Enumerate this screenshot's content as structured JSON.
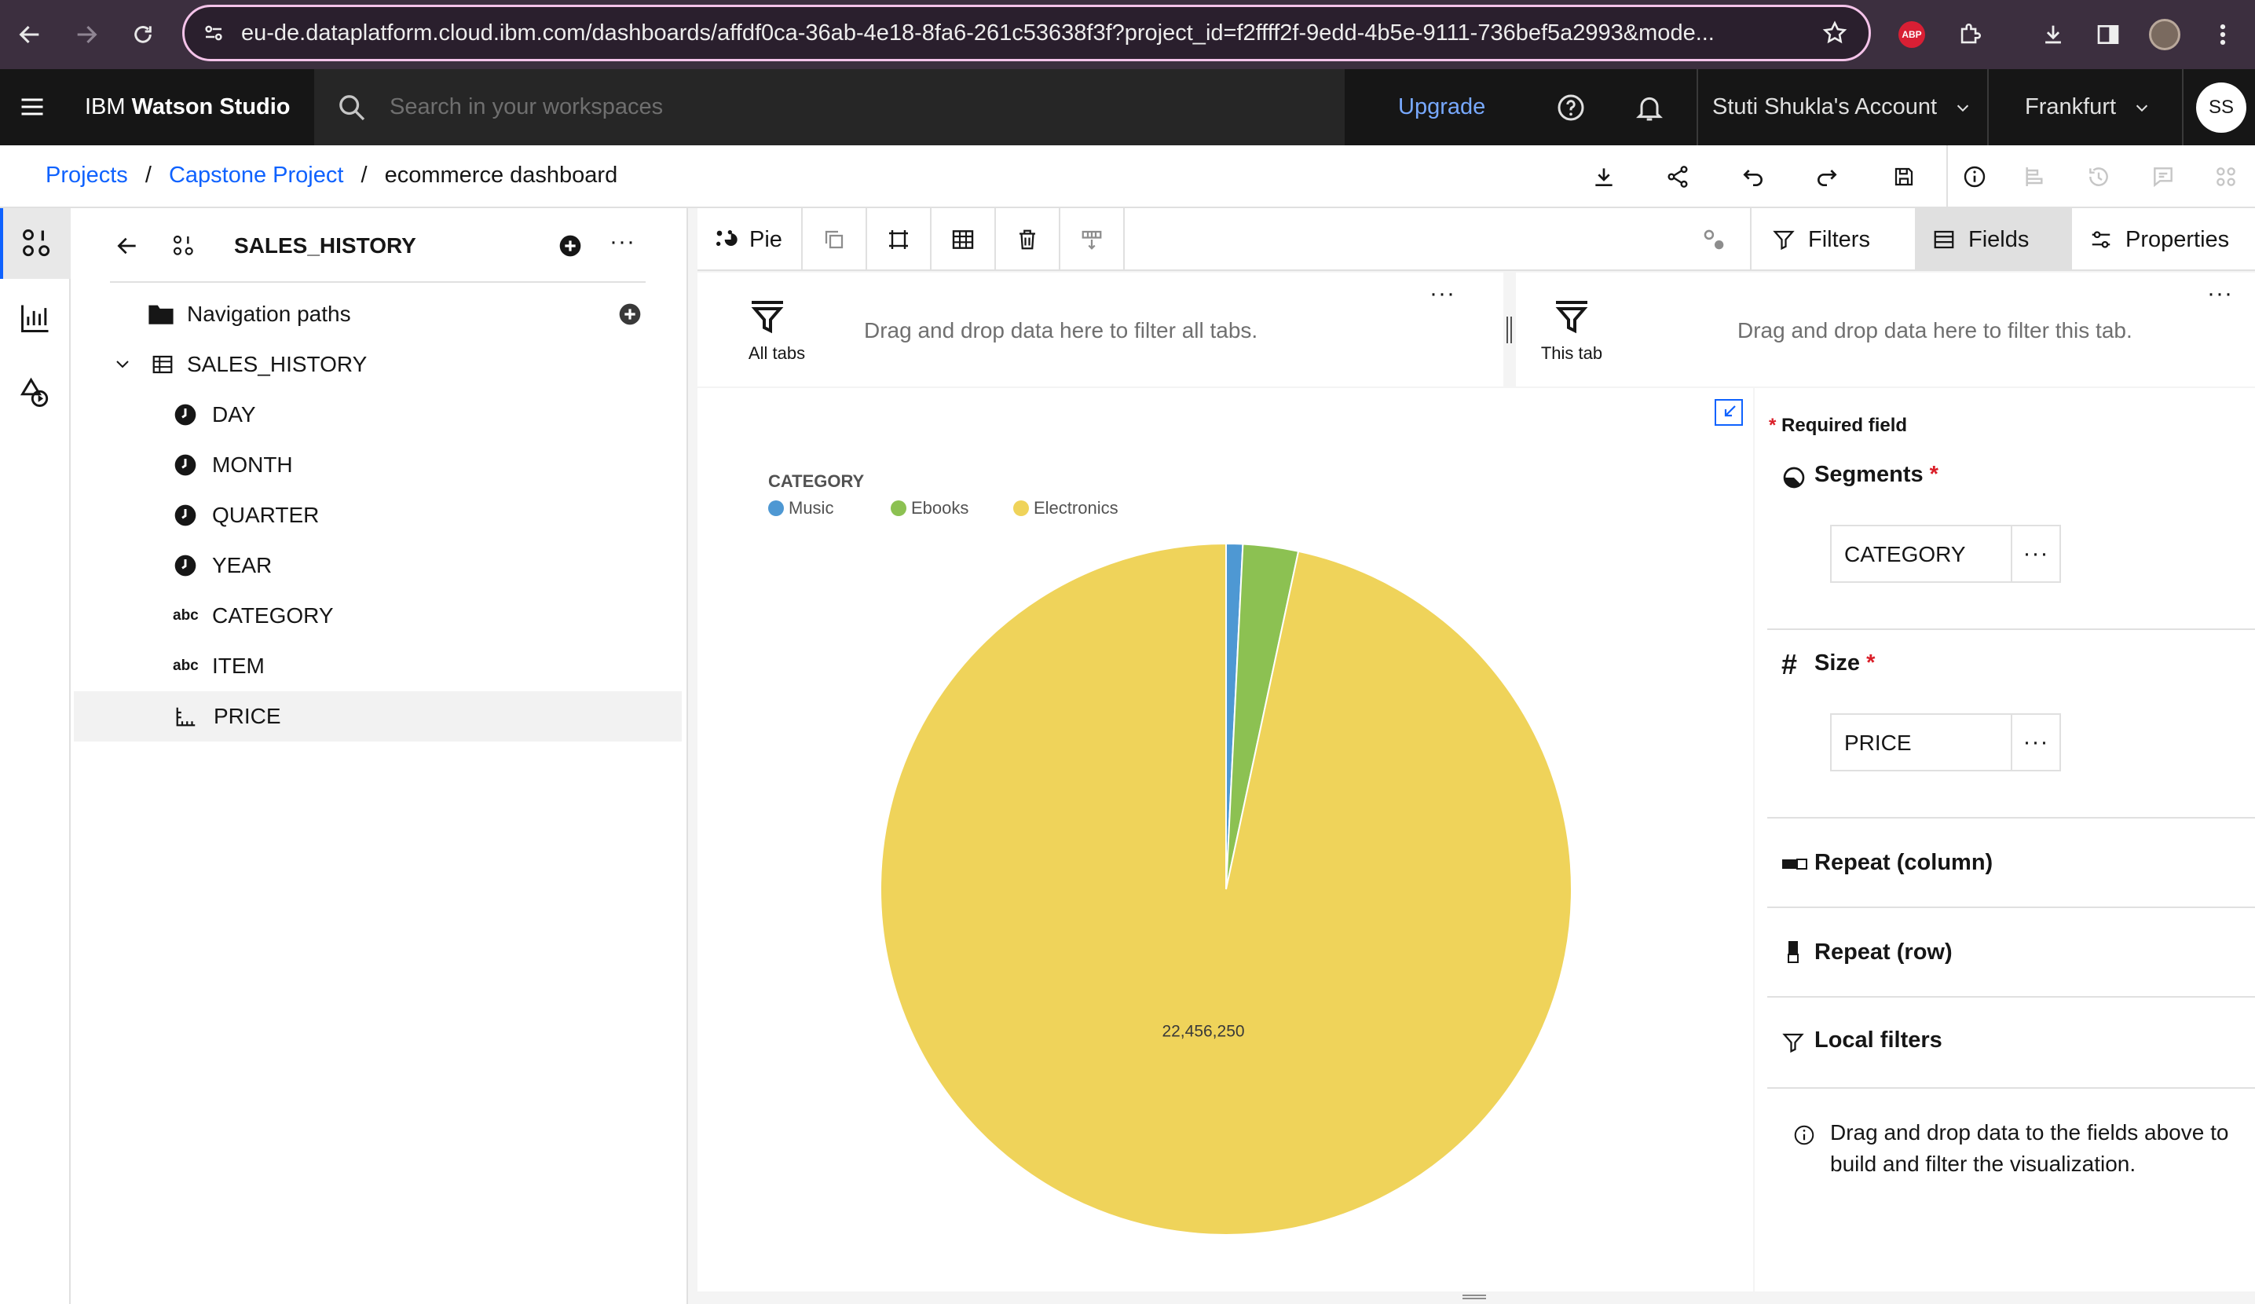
{
  "browser": {
    "url": "eu-de.dataplatform.cloud.ibm.com/dashboards/affdf0ca-36ab-4e18-8fa6-261c53638f3f?project_id=f2ffff2f-9edd-4b5e-9111-736bef5a2993&mode...",
    "adblock_label": "ABP"
  },
  "header": {
    "brand_prefix": "IBM",
    "brand_name": "Watson Studio",
    "search_placeholder": "Search in your workspaces",
    "upgrade": "Upgrade",
    "account": "Stuti Shukla's Account",
    "region": "Frankfurt",
    "avatar_initials": "SS"
  },
  "breadcrumb": {
    "items": [
      "Projects",
      "Capstone Project",
      "ecommerce dashboard"
    ],
    "separator": "/"
  },
  "data_panel": {
    "title": "SALES_HISTORY",
    "nav_paths": "Navigation paths",
    "table": "SALES_HISTORY",
    "fields": [
      {
        "name": "DAY",
        "icon": "clock-icon"
      },
      {
        "name": "MONTH",
        "icon": "clock-icon"
      },
      {
        "name": "QUARTER",
        "icon": "clock-icon"
      },
      {
        "name": "YEAR",
        "icon": "clock-icon"
      },
      {
        "name": "CATEGORY",
        "icon": "abc-icon"
      },
      {
        "name": "ITEM",
        "icon": "abc-icon"
      },
      {
        "name": "PRICE",
        "icon": "measure-icon"
      }
    ],
    "abc_glyph": "abc"
  },
  "canvas_toolbar": {
    "viz_type": "Pie",
    "tabs": {
      "filters": "Filters",
      "fields": "Fields",
      "properties": "Properties"
    }
  },
  "filters": {
    "all_tabs_label": "All tabs",
    "all_tabs_hint": "Drag and drop data here to filter all tabs.",
    "this_tab_label": "This tab",
    "this_tab_hint": "Drag and drop data here to filter this tab."
  },
  "chart_data": {
    "type": "pie",
    "legend_title": "CATEGORY",
    "categories": [
      "Music",
      "Ebooks",
      "Electronics"
    ],
    "values": [
      180000,
      600000,
      22456250
    ],
    "colors": [
      "#4e98d3",
      "#8cc152",
      "#efd35a"
    ],
    "data_labels": [
      "",
      "",
      "22,456,250"
    ]
  },
  "fields_panel": {
    "required_note": "Required field",
    "required_mark": "*",
    "segments": {
      "label": "Segments",
      "value": "CATEGORY"
    },
    "size": {
      "label": "Size",
      "value": "PRICE"
    },
    "repeat_column": "Repeat (column)",
    "repeat_row": "Repeat (row)",
    "local_filters": "Local filters",
    "info": "Drag and drop data to the fields above to build and filter the visualization."
  }
}
